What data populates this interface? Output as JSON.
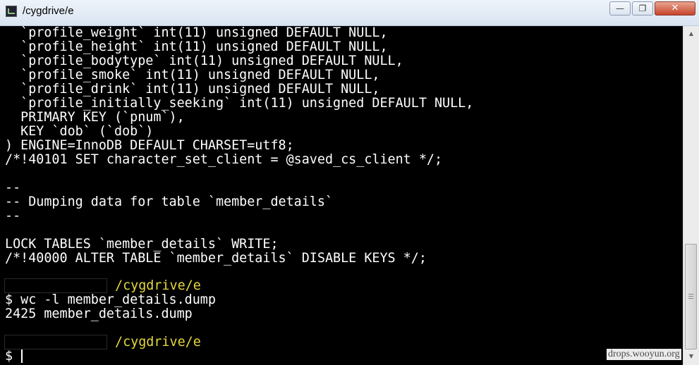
{
  "window": {
    "title": "/cygdrive/e",
    "buttons": {
      "minimize": "—",
      "maximize": "❐",
      "close": "✕"
    }
  },
  "terminal": {
    "lines": [
      "  `profile_weight` int(11) unsigned DEFAULT NULL,",
      "  `profile_height` int(11) unsigned DEFAULT NULL,",
      "  `profile_bodytype` int(11) unsigned DEFAULT NULL,",
      "  `profile_smoke` int(11) unsigned DEFAULT NULL,",
      "  `profile_drink` int(11) unsigned DEFAULT NULL,",
      "  `profile_initially_seeking` int(11) unsigned DEFAULT NULL,",
      "  PRIMARY KEY (`pnum`),",
      "  KEY `dob` (`dob`)",
      ") ENGINE=InnoDB DEFAULT CHARSET=utf8;",
      "/*!40101 SET character_set_client = @saved_cs_client */;",
      "",
      "--",
      "-- Dumping data for table `member_details`",
      "--",
      "",
      "LOCK TABLES `member_details` WRITE;",
      "/*!40000 ALTER TABLE `member_details` DISABLE KEYS */;"
    ],
    "prompt1_path": "/cygdrive/e",
    "command": "$ wc -l member_details.dump",
    "output": "2425 member_details.dump",
    "prompt2_path": "/cygdrive/e",
    "final_prompt": "$"
  },
  "scrollbar": {
    "up_arrow": "▲",
    "down_arrow": "▼"
  },
  "watermark": "drops.wooyun.org"
}
